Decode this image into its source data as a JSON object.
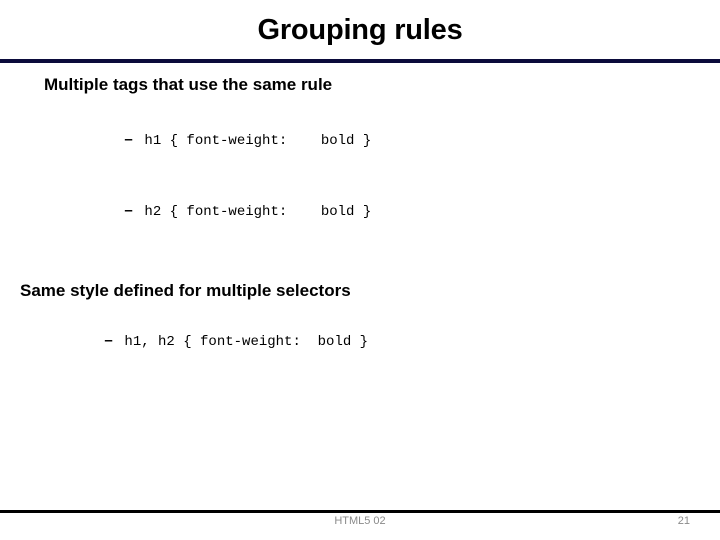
{
  "slide": {
    "title": "Grouping rules",
    "title_rule_color": "#0b0b3b",
    "sections": [
      {
        "heading": "Multiple tags that use the same rule",
        "items": [
          {
            "bullet": "–",
            "code": "h1 { font-weight:    bold }"
          },
          {
            "bullet": "–",
            "code": "h2 { font-weight:    bold }"
          }
        ]
      },
      {
        "heading": "Same style defined for multiple selectors",
        "items": [
          {
            "bullet": "–",
            "code": "h1, h2 { font-weight:  bold }"
          }
        ]
      }
    ]
  },
  "footer": {
    "center_label": "HTML5 02",
    "page_number": "21",
    "text_color": "#8a8a8a",
    "rule_color": "#000000"
  }
}
